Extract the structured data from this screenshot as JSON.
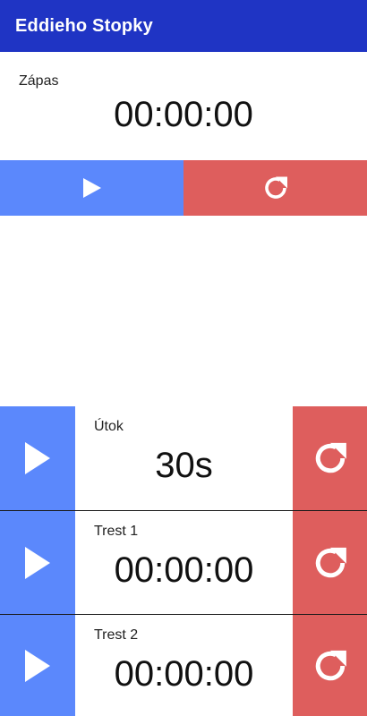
{
  "app": {
    "title": "Eddieho Stopky"
  },
  "match": {
    "label": "Zápas",
    "time": "00:00:00",
    "play_icon": "play-icon",
    "reset_icon": "refresh-icon"
  },
  "timers": [
    {
      "label": "Útok",
      "value": "30s"
    },
    {
      "label": "Trest 1",
      "value": "00:00:00"
    },
    {
      "label": "Trest 2",
      "value": "00:00:00"
    }
  ],
  "colors": {
    "appbar": "#1f34c4",
    "play": "#5b88fc",
    "reset": "#de5e5d"
  }
}
